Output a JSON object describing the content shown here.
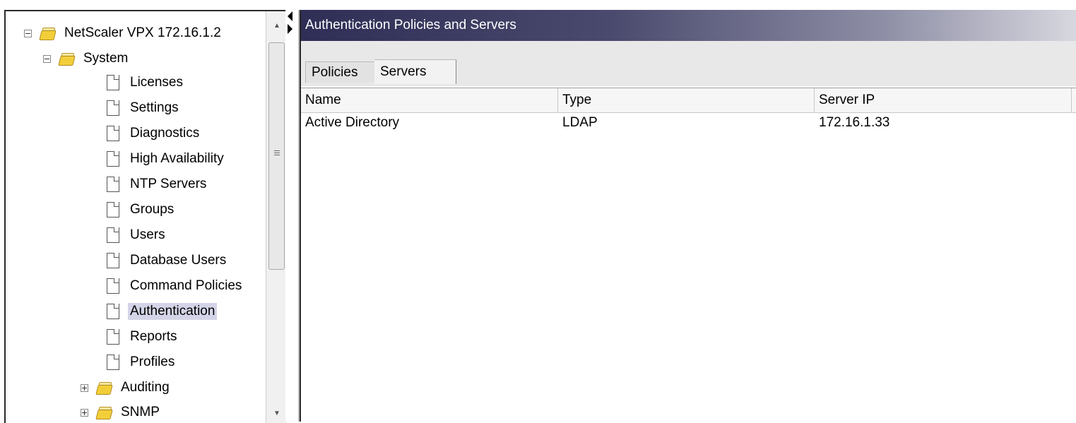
{
  "tree": {
    "root": {
      "label": "NetScaler VPX 172.16.1.2"
    },
    "system": {
      "label": "System"
    },
    "items": [
      {
        "label": "Licenses"
      },
      {
        "label": "Settings"
      },
      {
        "label": "Diagnostics"
      },
      {
        "label": "High Availability"
      },
      {
        "label": "NTP Servers"
      },
      {
        "label": "Groups"
      },
      {
        "label": "Users"
      },
      {
        "label": "Database Users"
      },
      {
        "label": "Command Policies"
      },
      {
        "label": "Authentication",
        "selected": true
      },
      {
        "label": "Reports"
      },
      {
        "label": "Profiles"
      }
    ],
    "collapsed_folders": [
      {
        "label": "Auditing"
      },
      {
        "label": "SNMP"
      }
    ]
  },
  "panel": {
    "title": "Authentication Policies and Servers",
    "tabs": [
      {
        "label": "Policies",
        "active": false
      },
      {
        "label": "Servers",
        "active": true
      }
    ],
    "table": {
      "columns": [
        "Name",
        "Type",
        "Server IP"
      ],
      "rows": [
        [
          "Active Directory",
          "LDAP",
          "172.16.1.33"
        ]
      ]
    }
  }
}
